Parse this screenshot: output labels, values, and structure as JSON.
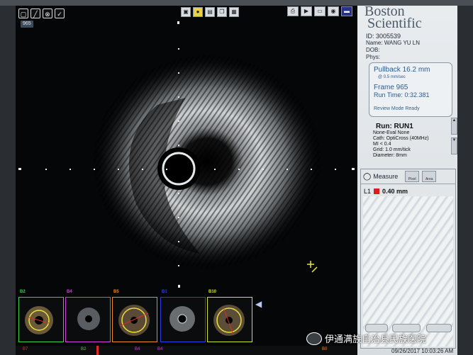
{
  "toolbar": {
    "left_icons": [
      "screen-icon",
      "pen-icon",
      "target-icon",
      "check-icon"
    ],
    "frame_tag": "965",
    "center_icons": [
      "print-icon",
      "settings-icon",
      "film-icon",
      "layers-icon",
      "grid-icon"
    ],
    "right_icons": [
      "printer-icon",
      "play-icon",
      "record-icon",
      "camera-icon",
      "monitor-icon"
    ]
  },
  "brand": {
    "line1": "Boston",
    "line2": "Scientific"
  },
  "patient": {
    "id": "ID: 3005539",
    "name": "Name: WANG YU LN",
    "dob": "DOB:",
    "phys": "Phys:"
  },
  "pullback": {
    "line1": "Pullback 16.2 mm",
    "speed": "@ 0.5 mm/sec",
    "frame": "Frame 965",
    "runtime": "Run Time: 0:32.381",
    "status": "Review Mode Ready"
  },
  "run": {
    "title": "Run: RUN1",
    "eval": "None-Eval None",
    "cath": "Cath: OptiCross (40MHz)",
    "mi": "MI < 0.4",
    "grid": "Grid: 1.0 mm/tick",
    "diameter": "Diameter: 8mm"
  },
  "measure": {
    "title": "Measure",
    "tab1": "Pixel",
    "tab2": "Area",
    "label": "L1",
    "value": "0.40 mm"
  },
  "thumbnails": [
    {
      "label": "B2",
      "color": "#3fd04a"
    },
    {
      "label": "B4",
      "color": "#d23ee0"
    },
    {
      "label": "B5",
      "color": "#f28a1c"
    },
    {
      "label": "B1",
      "color": "#2b3fe6"
    },
    {
      "label": "B10",
      "color": "#d6e12c"
    }
  ],
  "timeline_marks": [
    "B7",
    "B2",
    "B4",
    "B4",
    "B0"
  ],
  "datetime": "09/26/2017 10:03:26 AM",
  "watermark": "伊通满族自治县民族医院",
  "colors": {
    "ivus_tissue": "#cfd2d4",
    "measure_mark": "#d81e1e",
    "caliper": "#e6e83a"
  }
}
